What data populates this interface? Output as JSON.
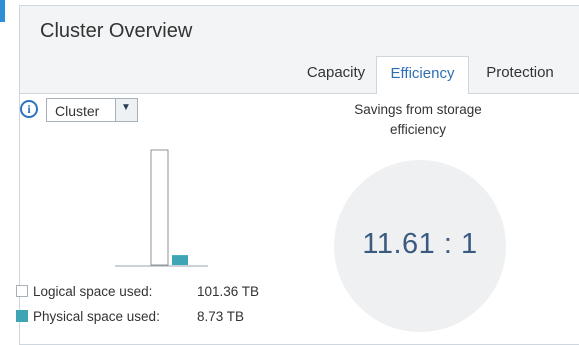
{
  "panel": {
    "title": "Cluster Overview"
  },
  "tabs": [
    {
      "label": "Capacity",
      "active": false
    },
    {
      "label": "Efficiency",
      "active": true
    },
    {
      "label": "Protection",
      "active": false
    }
  ],
  "scope_select": {
    "value": "Cluster",
    "info_icon": "info-icon",
    "arrow_icon": "chevron-down-icon"
  },
  "chart_data": {
    "type": "bar",
    "categories": [
      "Logical space used",
      "Physical space used"
    ],
    "values": [
      101.36,
      8.73
    ],
    "unit": "TB",
    "colors": [
      "#ffffff",
      "#3ea5b5"
    ],
    "ylim": [
      0,
      101.36
    ],
    "grid": false
  },
  "legend": [
    {
      "label": "Logical space used:",
      "value": "101.36 TB",
      "color": "#ffffff"
    },
    {
      "label": "Physical space used:",
      "value": "8.73 TB",
      "color": "#3ea5b5"
    }
  ],
  "savings": {
    "label_line1": "Savings from storage",
    "label_line2": "efficiency",
    "ratio": "11.61 : 1"
  },
  "colors": {
    "accent": "#2f6fb6",
    "physical": "#3ea5b5",
    "circle": "#eef0f2"
  }
}
